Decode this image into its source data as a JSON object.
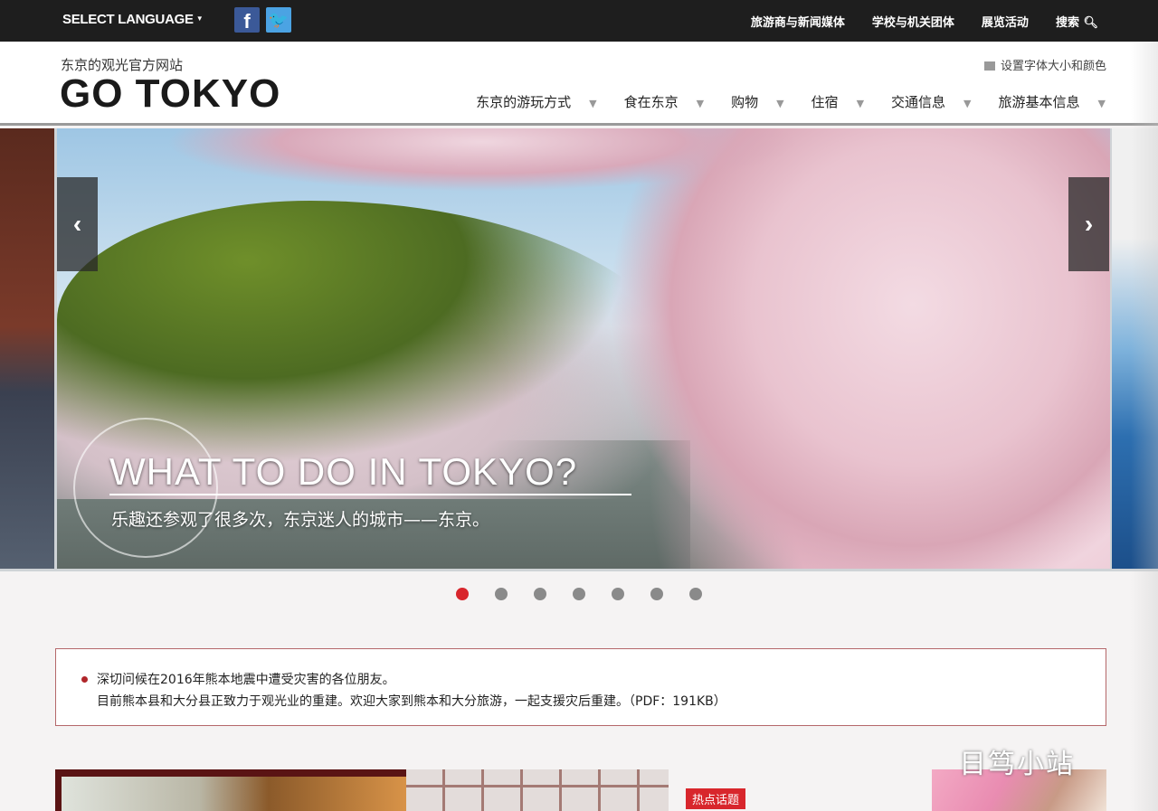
{
  "topbar": {
    "language": "SELECT LANGUAGE",
    "facebook": "f",
    "twitter": "t",
    "links": [
      "旅游商与新闻媒体",
      "学校与机关团体",
      "展览活动",
      "搜索"
    ]
  },
  "header": {
    "tagline": "东京的观光官方网站",
    "logo": "GO TOKYO",
    "font_settings": "设置字体大小和颜色",
    "nav": [
      "东京的游玩方式",
      "食在东京",
      "购物",
      "住宿",
      "交通信息",
      "旅游基本信息"
    ]
  },
  "hero": {
    "title": "WHAT TO DO IN TOKYO?",
    "subtitle": "乐趣还参观了很多次，东京迷人的城市——东京。",
    "prev": "‹",
    "next": "›",
    "slide_count": 7,
    "active_slide": 1
  },
  "notice": {
    "line1": "深切问候在2016年熊本地震中遭受灾害的各位朋友。",
    "line2": "目前熊本县和大分县正致力于观光业的重建。欢迎大家到熊本和大分旅游，一起支援灾后重建。（PDF：191KB）"
  },
  "cards": {
    "badge": "热点话题"
  },
  "watermark": "日笃小站",
  "colors": {
    "accent": "#d8262c",
    "topbar": "#1e1e1e"
  }
}
